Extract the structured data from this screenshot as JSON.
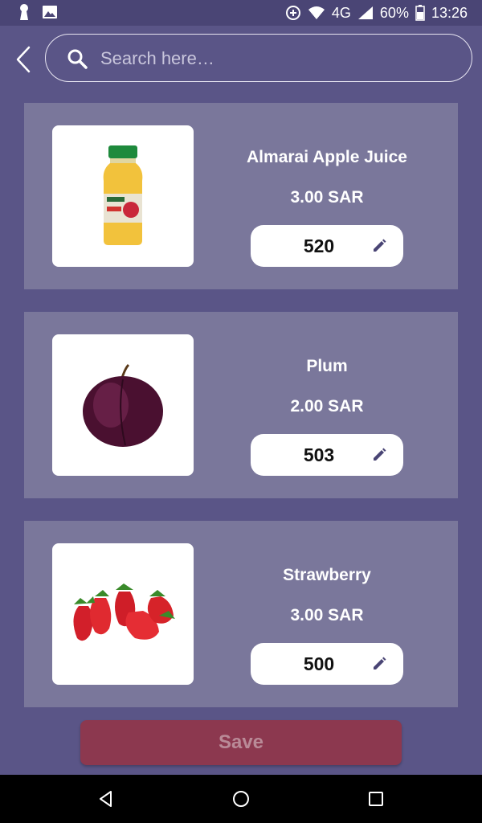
{
  "status_bar": {
    "network": "4G",
    "battery": "60%",
    "time": "13:26",
    "icons": [
      "keyhole-icon",
      "image-icon",
      "data-saver-icon",
      "wifi-icon",
      "signal-icon",
      "battery-icon"
    ]
  },
  "search": {
    "placeholder": "Search here…"
  },
  "products": [
    {
      "name": "Almarai Apple Juice",
      "price": "3.00 SAR",
      "quantity": "520",
      "image": "apple-juice-bottle"
    },
    {
      "name": "Plum",
      "price": "2.00 SAR",
      "quantity": "503",
      "image": "plum"
    },
    {
      "name": "Strawberry",
      "price": "3.00 SAR",
      "quantity": "500",
      "image": "strawberries"
    }
  ],
  "actions": {
    "save_label": "Save"
  },
  "colors": {
    "background": "#5a5587",
    "card": "#7a779b",
    "save_button": "#8c384f",
    "accent": "#4a4575"
  }
}
